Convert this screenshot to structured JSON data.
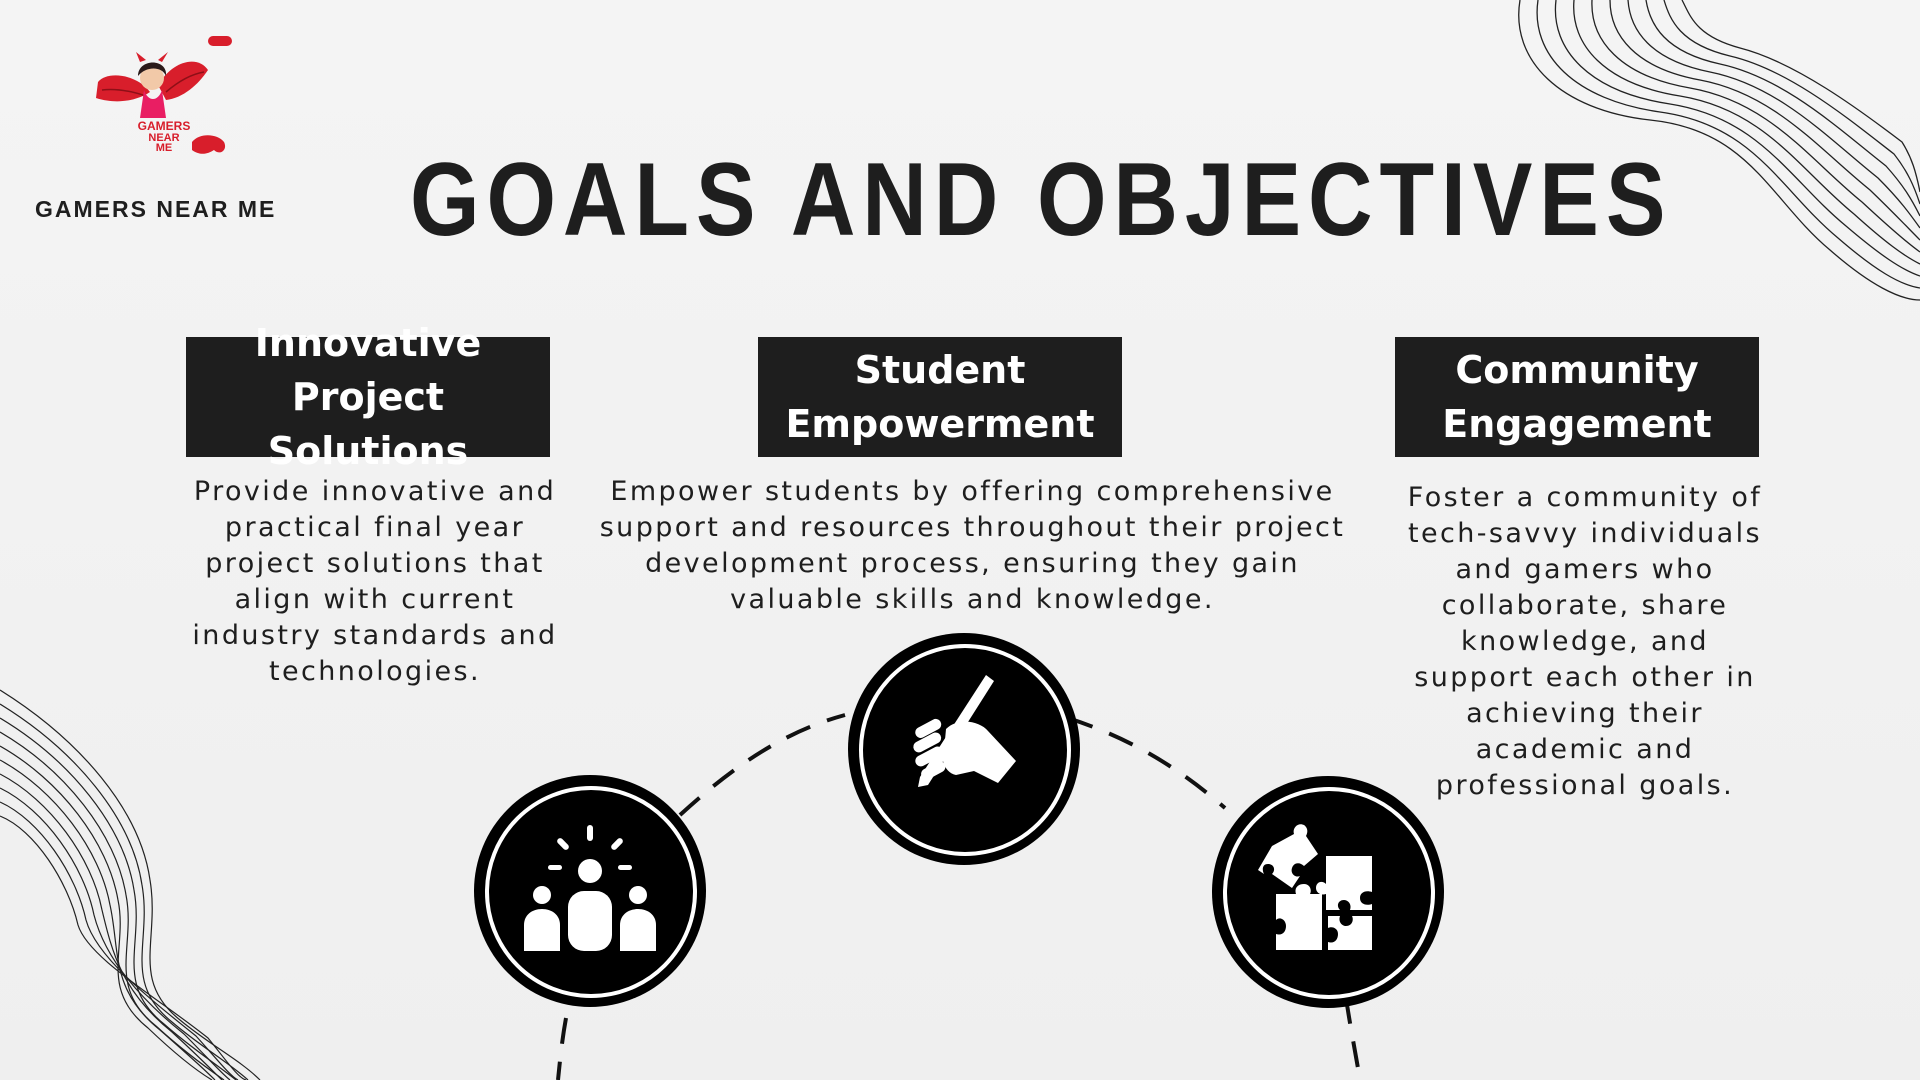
{
  "brand": {
    "name": "GAMERS NEAR ME"
  },
  "title": "GOALS AND OBJECTIVES",
  "objectives": [
    {
      "heading": "Innovative Project Solutions",
      "icon": "team-icon",
      "text": "Provide innovative and practical final year project solutions that align with current industry standards and technologies."
    },
    {
      "heading": "Student Empowerment",
      "icon": "hand-holding-pen-icon",
      "text": "Empower students by offering comprehensive support and resources throughout their project development process, ensuring they gain valuable skills and knowledge."
    },
    {
      "heading": "Community Engagement",
      "icon": "puzzle-icon",
      "text": "Foster a community of tech-savvy individuals and gamers who collaborate, share knowledge, and support each other in achieving their academic and professional goals."
    }
  ],
  "colors": {
    "background": "#f2f2f2",
    "dark": "#1e1e1e",
    "logo_red": "#d81e2b",
    "logo_pink": "#e91e63"
  }
}
